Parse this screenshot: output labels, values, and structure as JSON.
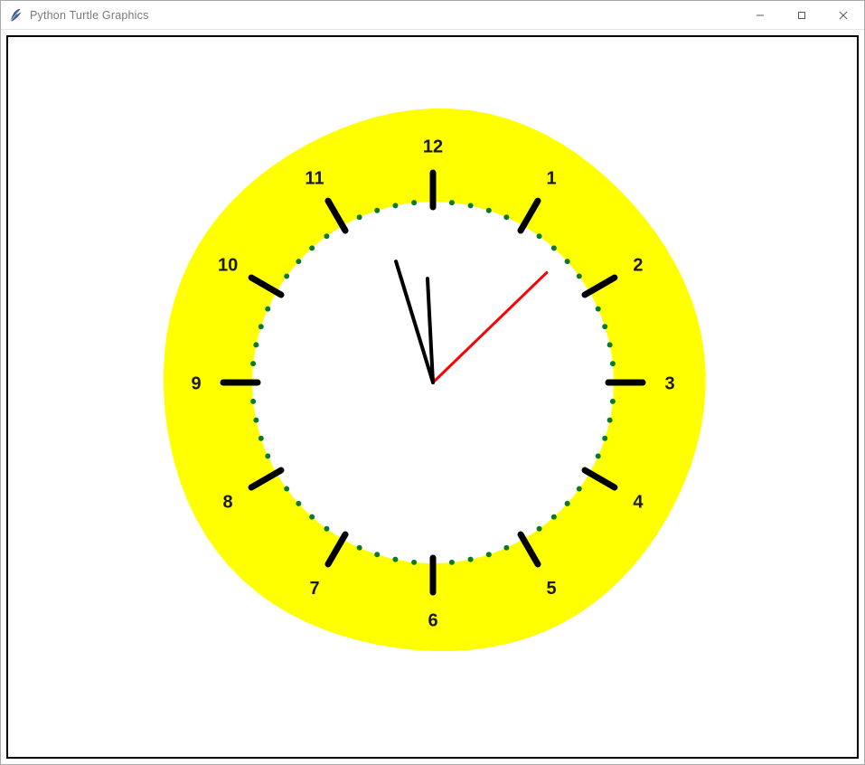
{
  "window": {
    "title": "Python Turtle Graphics"
  },
  "clock": {
    "face_color": "#ffff00",
    "inner_color": "#ffffff",
    "tick_color": "#000000",
    "dot_color": "#0a7a2a",
    "hour_hand_color": "#000000",
    "minute_hand_color": "#000000",
    "second_hand_color": "#ff0000",
    "outer_radius": 300,
    "inner_radius": 200,
    "numbers": [
      "12",
      "1",
      "2",
      "3",
      "4",
      "5",
      "6",
      "7",
      "8",
      "9",
      "10",
      "11"
    ],
    "time": {
      "hour": 11,
      "minute": 59,
      "second": 8,
      "hour_angle_deg": -17,
      "minute_angle_deg": -3,
      "second_angle_deg": 46
    }
  }
}
